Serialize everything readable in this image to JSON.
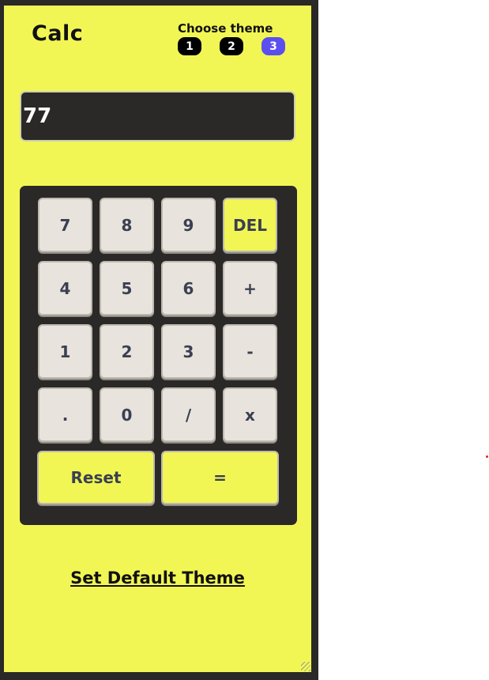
{
  "app": {
    "title": "Calc"
  },
  "theme": {
    "label": "Choose theme",
    "options": [
      "1",
      "2",
      "3"
    ],
    "active": "3",
    "colors": {
      "active": "#5c4ff0",
      "inactive": "#000000"
    }
  },
  "display": {
    "value": "77"
  },
  "keys": {
    "k7": "7",
    "k8": "8",
    "k9": "9",
    "del": "DEL",
    "k4": "4",
    "k5": "5",
    "k6": "6",
    "plus": "+",
    "k1": "1",
    "k2": "2",
    "k3": "3",
    "minus": "-",
    "dot": ".",
    "k0": "0",
    "divide": "/",
    "multiply": "x",
    "reset": "Reset",
    "equals": "="
  },
  "footer": {
    "default_theme_link": "Set Default Theme"
  },
  "colors": {
    "background": "#f1f654",
    "panel": "#2a2927",
    "key": "#e8e3dc",
    "accent_key": "#f1f654",
    "key_text": "#3a3f52"
  }
}
